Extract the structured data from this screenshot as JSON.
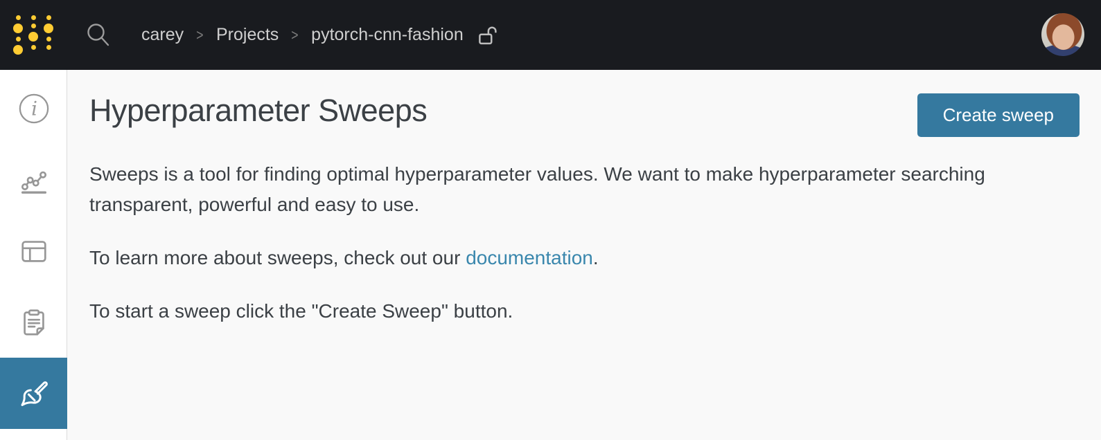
{
  "topbar": {
    "logo": "wandb-logo",
    "search_icon": "search-icon",
    "breadcrumb": {
      "entity": "carey",
      "section": "Projects",
      "project": "pytorch-cnn-fashion",
      "separator": ">",
      "visibility_icon": "unlock-icon"
    },
    "avatar": "user-avatar"
  },
  "sidebar": {
    "items": [
      {
        "icon": "info-icon",
        "name": "overview"
      },
      {
        "icon": "line-chart-icon",
        "name": "charts"
      },
      {
        "icon": "table-icon",
        "name": "table"
      },
      {
        "icon": "notes-icon",
        "name": "notes"
      },
      {
        "icon": "sweeps-broom-icon",
        "name": "sweeps",
        "active": true
      }
    ]
  },
  "main": {
    "title": "Hyperparameter Sweeps",
    "create_button_label": "Create sweep",
    "paragraph1": "Sweeps is a tool for finding optimal hyperparameter values. We want to make hyperparameter searching transparent, powerful and easy to use.",
    "paragraph2": {
      "before": "To learn more about sweeps, check out our ",
      "link": "documentation",
      "after": "."
    },
    "paragraph3": "To start a sweep click the \"Create Sweep\" button."
  },
  "colors": {
    "topbar_bg": "#191b1f",
    "brand_gold": "#ffcc33",
    "accent_blue": "#35799f",
    "link_blue": "#3a87ad",
    "page_bg": "#f9f9f9",
    "text": "#3b4045"
  }
}
